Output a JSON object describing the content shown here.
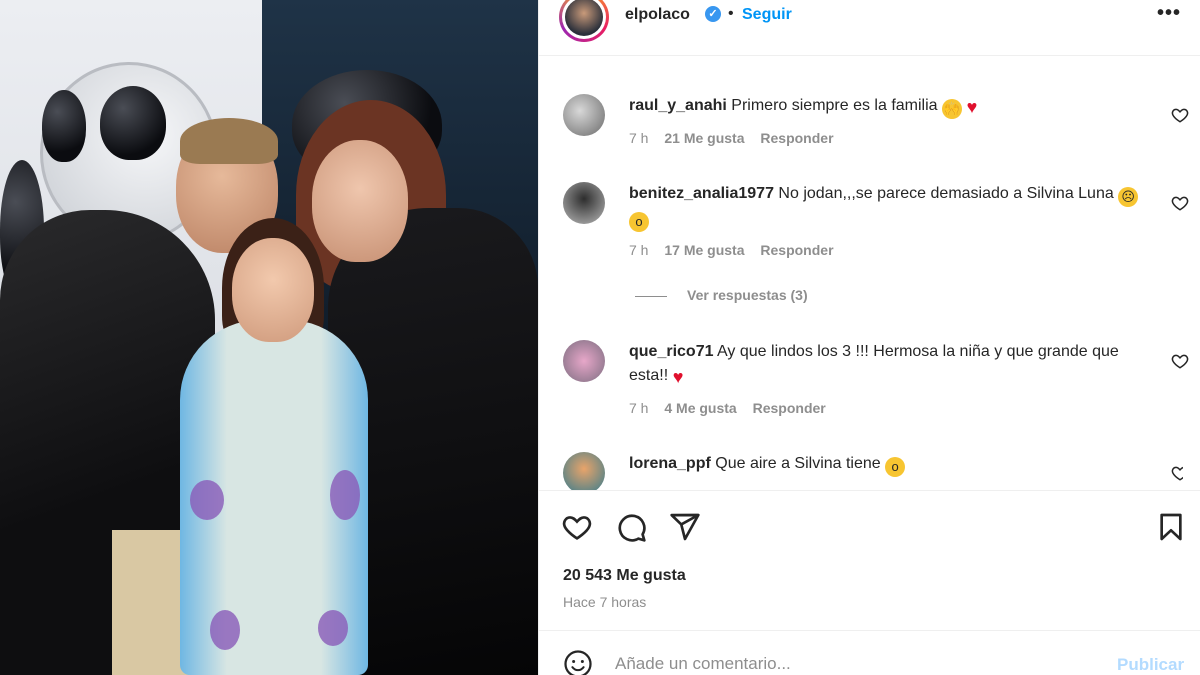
{
  "header": {
    "username": "elpolaco",
    "separator": "•",
    "follow_label": "Seguir",
    "more_label": "•••"
  },
  "comments": [
    {
      "user": "raul_y_anahi",
      "text": "Primero siempre es la familia",
      "emojis": [
        "praying-hands",
        "red-heart"
      ],
      "time": "7 h",
      "likes": "21 Me gusta",
      "reply": "Responder"
    },
    {
      "user": "benitez_analia1977",
      "text": "No jodan,,,se parece demasiado a Silvina Luna",
      "emojis": [
        "sad-face",
        "astonished-face"
      ],
      "time": "7 h",
      "likes": "17 Me gusta",
      "reply": "Responder"
    },
    {
      "user": "que_rico71",
      "text": "Ay que lindos los 3 !!! Hermosa la niña y que grande que esta!!",
      "emojis": [
        "red-heart"
      ],
      "time": "7 h",
      "likes": "4 Me gusta",
      "reply": "Responder"
    },
    {
      "user": "lorena_ppf",
      "text": "Que aire a Silvina tiene",
      "emojis": [
        "astonished-face"
      ]
    }
  ],
  "view_replies": "Ver respuestas (3)",
  "post": {
    "likes": "20 543 Me gusta",
    "time": "Hace 7 horas"
  },
  "add_comment": {
    "placeholder": "Añade un comentario...",
    "publish_label": "Publicar"
  },
  "icons": {
    "like": "heart-icon",
    "comment": "comment-icon",
    "share": "paper-plane-icon",
    "save": "bookmark-icon",
    "emoji": "smiley-icon"
  },
  "colors": {
    "link_blue": "#0095f6",
    "publish_disabled": "#b3dbff",
    "verified": "#3897f0",
    "heart_red": "#e0102d"
  }
}
